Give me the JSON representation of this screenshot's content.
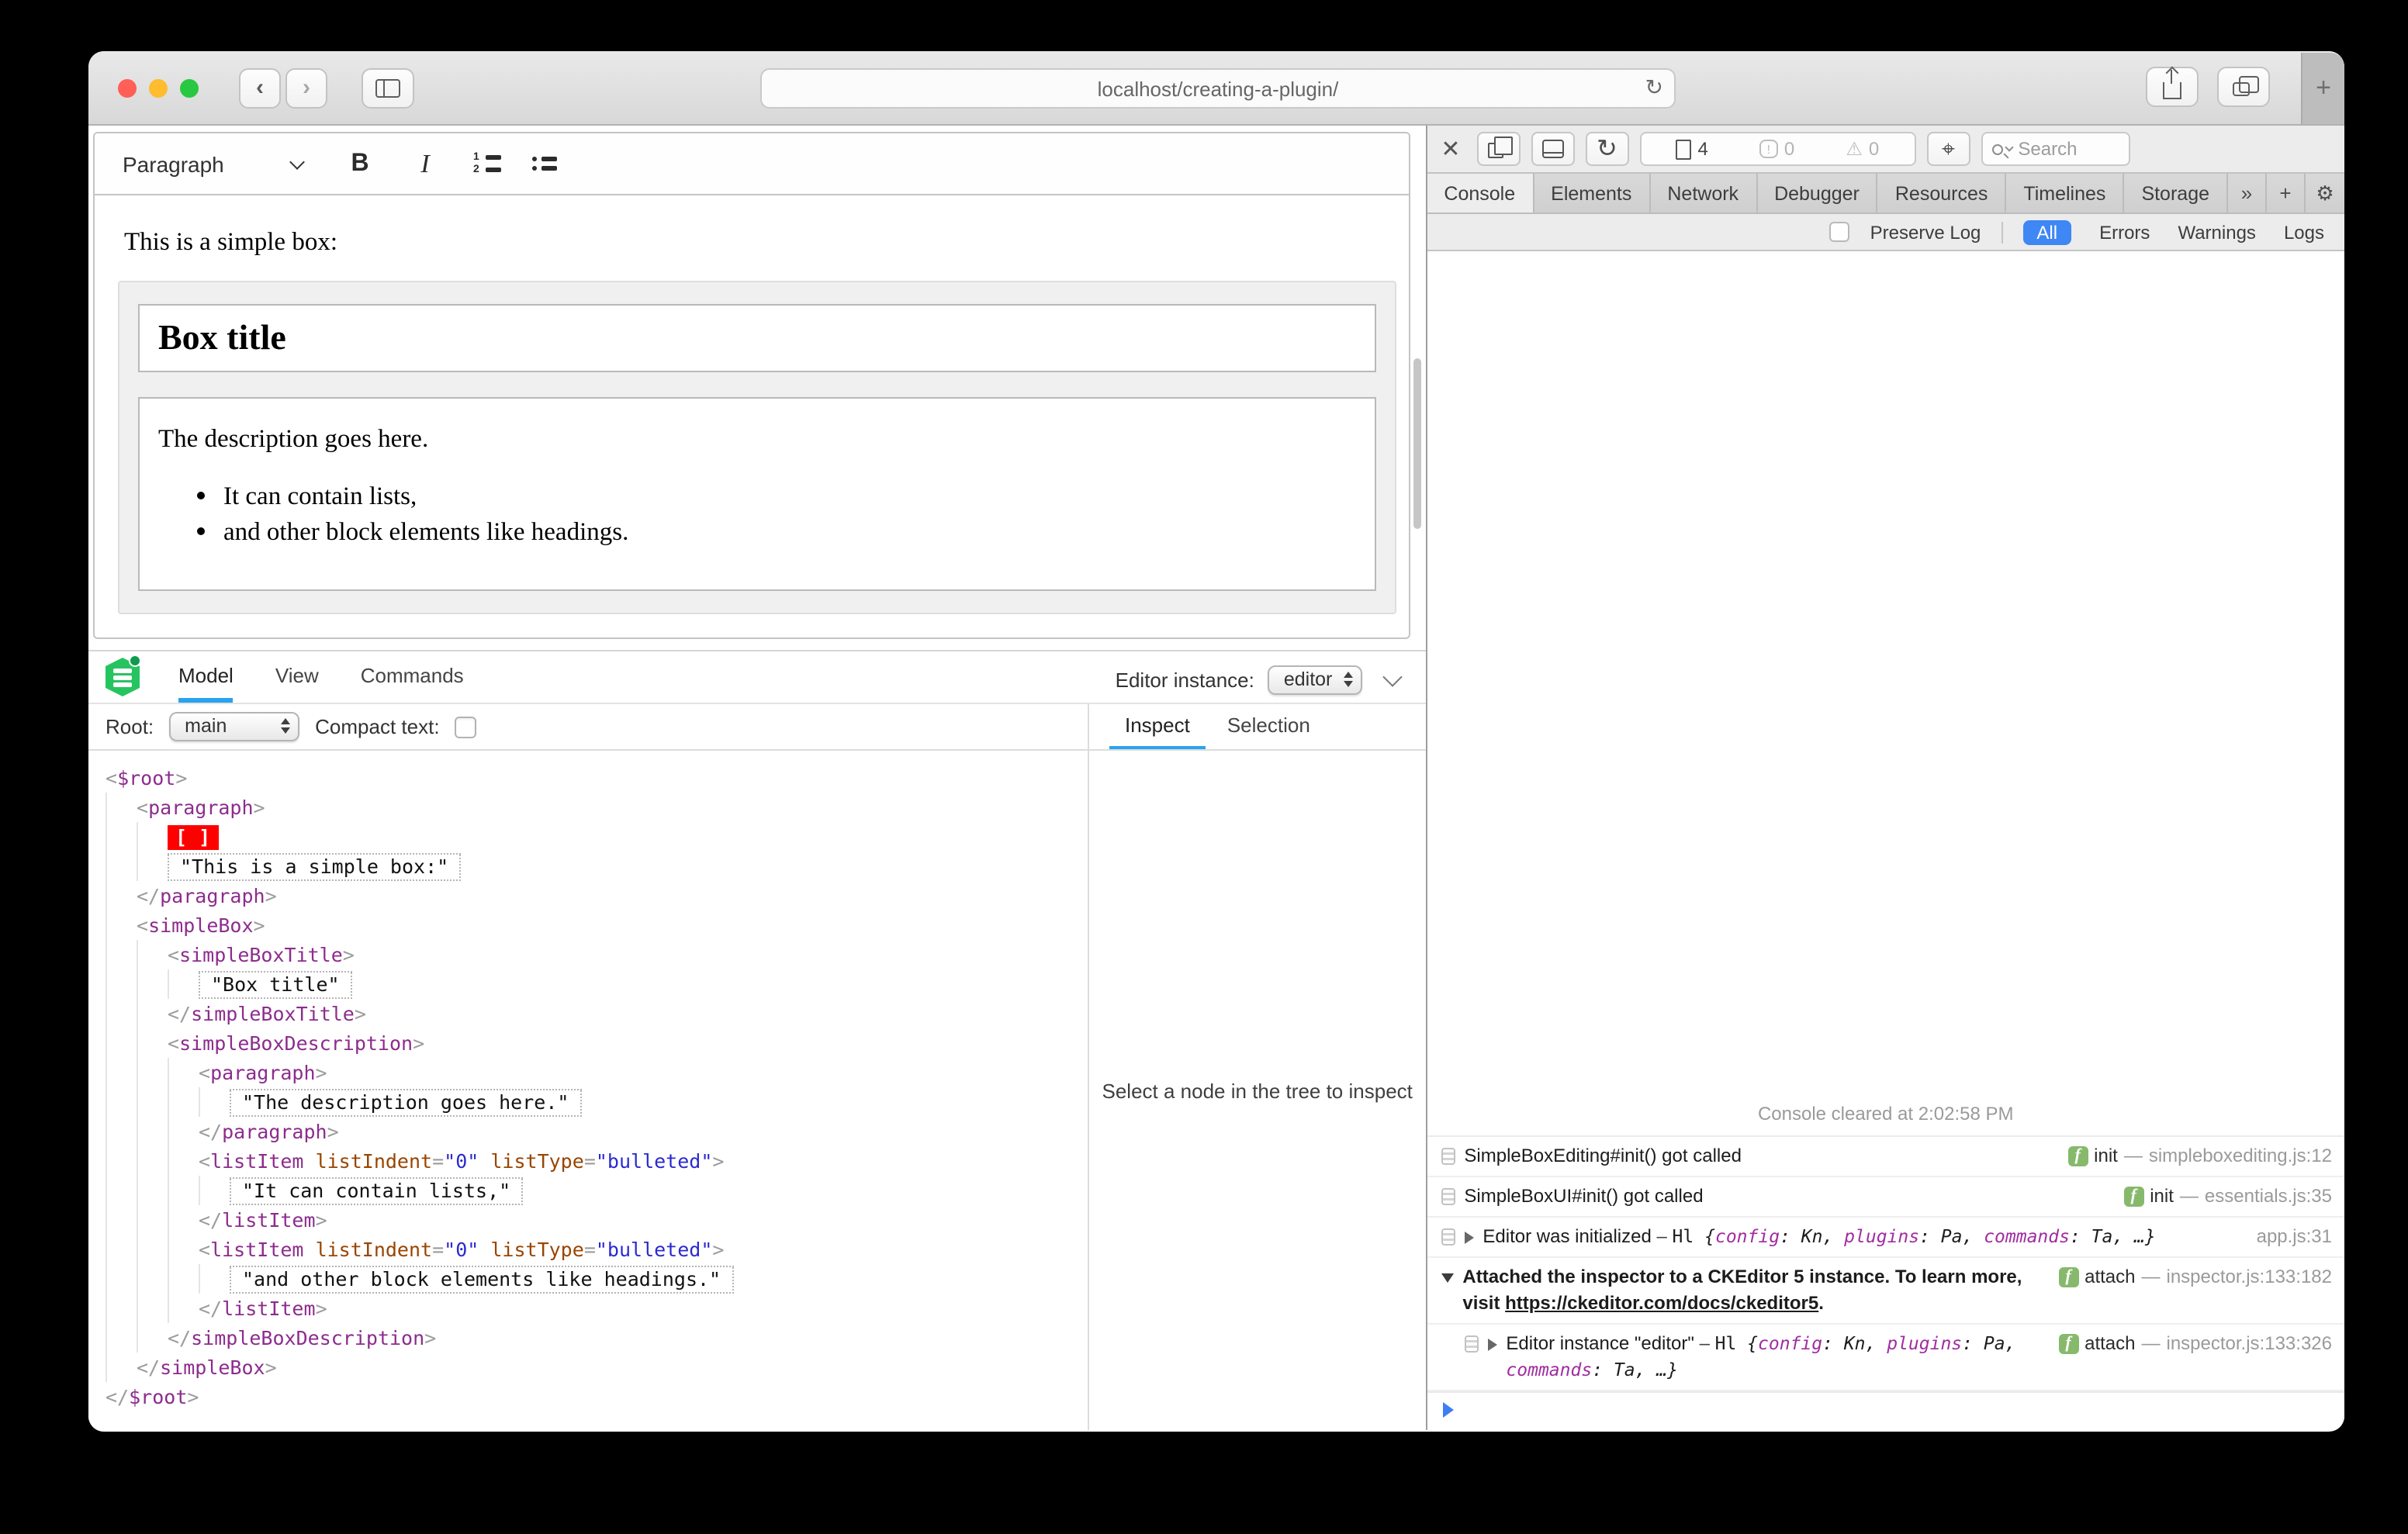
{
  "colors": {
    "accent_blue": "#2aa3ef",
    "filter_blue": "#3f87f5",
    "selection_red": "#ff0000",
    "tag_purple": "#8d2c8d",
    "attr_brown": "#994500",
    "value_blue": "#2a2ad0",
    "logo_green": "#26c460",
    "badge_green": "#87b96c",
    "light_close": "#ff5f57",
    "light_min": "#febc2e",
    "light_zoom": "#28c840"
  },
  "browser": {
    "url": "localhost/creating-a-plugin/",
    "icons": {
      "back": "‹",
      "forward": "›",
      "reload": "↻",
      "new_tab": "+"
    }
  },
  "editor": {
    "toolbar": {
      "paragraph_label": "Paragraph"
    },
    "content": {
      "intro": "This is a simple box:",
      "box_title": "Box title",
      "description": "The description goes here.",
      "list_items": [
        "It can contain lists,",
        "and other block elements like headings."
      ]
    }
  },
  "inspector": {
    "tabs": [
      "Model",
      "View",
      "Commands"
    ],
    "active_tab": "Model",
    "editor_instance_label": "Editor instance:",
    "editor_instance_value": "editor",
    "root_label": "Root:",
    "root_value": "main",
    "compact_text_label": "Compact text:",
    "side_tabs": [
      "Inspect",
      "Selection"
    ],
    "active_side_tab": "Inspect",
    "empty_message": "Select a node in the tree to inspect",
    "tree": [
      {
        "indent": 0,
        "tokens": [
          [
            "p",
            "<"
          ],
          [
            "tag",
            "$root"
          ],
          [
            "p",
            ">"
          ]
        ]
      },
      {
        "indent": 1,
        "tokens": [
          [
            "p",
            "<"
          ],
          [
            "tag",
            "paragraph"
          ],
          [
            "p",
            ">"
          ]
        ]
      },
      {
        "indent": 2,
        "tokens": [
          [
            "sel",
            "[ ]"
          ]
        ]
      },
      {
        "indent": 2,
        "tokens": [
          [
            "txt",
            "\"This is a simple box:\""
          ]
        ]
      },
      {
        "indent": 1,
        "tokens": [
          [
            "p",
            "</"
          ],
          [
            "tag",
            "paragraph"
          ],
          [
            "p",
            ">"
          ]
        ]
      },
      {
        "indent": 1,
        "tokens": [
          [
            "p",
            "<"
          ],
          [
            "tag",
            "simpleBox"
          ],
          [
            "p",
            ">"
          ]
        ]
      },
      {
        "indent": 2,
        "tokens": [
          [
            "p",
            "<"
          ],
          [
            "tag",
            "simpleBoxTitle"
          ],
          [
            "p",
            ">"
          ]
        ]
      },
      {
        "indent": 3,
        "tokens": [
          [
            "txt",
            "\"Box title\""
          ]
        ]
      },
      {
        "indent": 2,
        "tokens": [
          [
            "p",
            "</"
          ],
          [
            "tag",
            "simpleBoxTitle"
          ],
          [
            "p",
            ">"
          ]
        ]
      },
      {
        "indent": 2,
        "tokens": [
          [
            "p",
            "<"
          ],
          [
            "tag",
            "simpleBoxDescription"
          ],
          [
            "p",
            ">"
          ]
        ]
      },
      {
        "indent": 3,
        "tokens": [
          [
            "p",
            "<"
          ],
          [
            "tag",
            "paragraph"
          ],
          [
            "p",
            ">"
          ]
        ]
      },
      {
        "indent": 4,
        "tokens": [
          [
            "txt",
            "\"The description goes here.\""
          ]
        ]
      },
      {
        "indent": 3,
        "tokens": [
          [
            "p",
            "</"
          ],
          [
            "tag",
            "paragraph"
          ],
          [
            "p",
            ">"
          ]
        ]
      },
      {
        "indent": 3,
        "tokens": [
          [
            "p",
            "<"
          ],
          [
            "tag",
            "listItem"
          ],
          [
            "sp",
            " "
          ],
          [
            "attr",
            "listIndent"
          ],
          [
            "p",
            "="
          ],
          [
            "val",
            "\"0\""
          ],
          [
            "sp",
            " "
          ],
          [
            "attr",
            "listType"
          ],
          [
            "p",
            "="
          ],
          [
            "val",
            "\"bulleted\""
          ],
          [
            "p",
            ">"
          ]
        ]
      },
      {
        "indent": 4,
        "tokens": [
          [
            "txt",
            "\"It can contain lists,\""
          ]
        ]
      },
      {
        "indent": 3,
        "tokens": [
          [
            "p",
            "</"
          ],
          [
            "tag",
            "listItem"
          ],
          [
            "p",
            ">"
          ]
        ]
      },
      {
        "indent": 3,
        "tokens": [
          [
            "p",
            "<"
          ],
          [
            "tag",
            "listItem"
          ],
          [
            "sp",
            " "
          ],
          [
            "attr",
            "listIndent"
          ],
          [
            "p",
            "="
          ],
          [
            "val",
            "\"0\""
          ],
          [
            "sp",
            " "
          ],
          [
            "attr",
            "listType"
          ],
          [
            "p",
            "="
          ],
          [
            "val",
            "\"bulleted\""
          ],
          [
            "p",
            ">"
          ]
        ]
      },
      {
        "indent": 4,
        "tokens": [
          [
            "txt",
            "\"and other block elements like headings.\""
          ]
        ]
      },
      {
        "indent": 3,
        "tokens": [
          [
            "p",
            "</"
          ],
          [
            "tag",
            "listItem"
          ],
          [
            "p",
            ">"
          ]
        ]
      },
      {
        "indent": 2,
        "tokens": [
          [
            "p",
            "</"
          ],
          [
            "tag",
            "simpleBoxDescription"
          ],
          [
            "p",
            ">"
          ]
        ]
      },
      {
        "indent": 1,
        "tokens": [
          [
            "p",
            "</"
          ],
          [
            "tag",
            "simpleBox"
          ],
          [
            "p",
            ">"
          ]
        ]
      },
      {
        "indent": 0,
        "tokens": [
          [
            "p",
            "</"
          ],
          [
            "tag",
            "$root"
          ],
          [
            "p",
            ">"
          ]
        ]
      }
    ]
  },
  "webinspector": {
    "tabs": [
      "Console",
      "Elements",
      "Network",
      "Debugger",
      "Resources",
      "Timelines",
      "Storage"
    ],
    "active_tab": "Console",
    "toolbar": {
      "page_count": "4",
      "error_count": "0",
      "warning_count": "0",
      "search_placeholder": "Search",
      "icons": {
        "close": "✕",
        "reload": "↻",
        "chevron_double": "»",
        "add": "+",
        "gear": "⚙",
        "crosshair": "⌖",
        "warning": "⚠",
        "error": "!"
      }
    },
    "filters": {
      "preserve_log_label": "Preserve Log",
      "scopes": [
        "All",
        "Errors",
        "Warnings",
        "Logs"
      ],
      "active_scope": "All"
    },
    "cleared_message": "Console cleared at 2:02:58 PM",
    "function_badge": "f",
    "entries": [
      {
        "icon": true,
        "disclosure": null,
        "nested": false,
        "tokens": [
          [
            "plain",
            "SimpleBoxEditing#init() got called"
          ]
        ],
        "fn": "init",
        "loc": "simpleboxediting.js:12"
      },
      {
        "icon": true,
        "disclosure": null,
        "nested": false,
        "tokens": [
          [
            "plain",
            "SimpleBoxUI#init() got called"
          ]
        ],
        "fn": "init",
        "loc": "essentials.js:35"
      },
      {
        "icon": true,
        "disclosure": "closed",
        "nested": false,
        "tokens": [
          [
            "plain",
            "Editor was initialized"
          ],
          [
            "dash",
            " – "
          ],
          [
            "code",
            "Hl "
          ],
          [
            "obj",
            "{"
          ],
          [
            "key",
            "config"
          ],
          [
            "obj",
            ": Kn, "
          ],
          [
            "key",
            "plugins"
          ],
          [
            "obj",
            ": Pa, "
          ],
          [
            "key",
            "commands"
          ],
          [
            "obj",
            ": Ta, …}"
          ]
        ],
        "fn": null,
        "loc": "app.js:31"
      },
      {
        "icon": false,
        "disclosure": "open",
        "nested": false,
        "tokens": [
          [
            "bold",
            "Attached the inspector to a CKEditor 5 instance. To learn more, visit "
          ],
          [
            "link",
            "https://ckeditor.com/docs/ckeditor5"
          ],
          [
            "bold",
            "."
          ]
        ],
        "fn": "attach",
        "loc": "inspector.js:133:182"
      },
      {
        "icon": true,
        "disclosure": "closed",
        "nested": true,
        "tokens": [
          [
            "plain",
            "Editor instance \"editor\""
          ],
          [
            "dash",
            " – "
          ],
          [
            "code",
            "Hl "
          ],
          [
            "obj",
            "{"
          ],
          [
            "key",
            "config"
          ],
          [
            "obj",
            ": Kn, "
          ],
          [
            "key",
            "plugins"
          ],
          [
            "obj",
            ": Pa, "
          ],
          [
            "key",
            "commands"
          ],
          [
            "obj",
            ": Ta, …}"
          ]
        ],
        "fn": "attach",
        "loc": "inspector.js:133:326"
      }
    ]
  }
}
